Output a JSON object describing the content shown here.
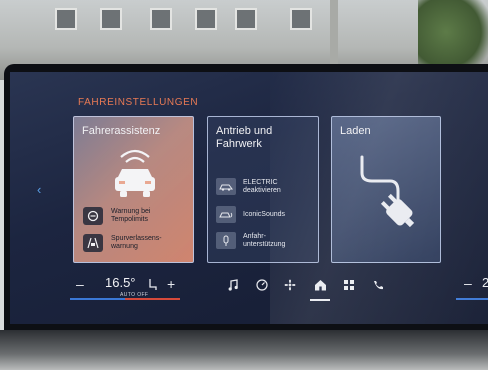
{
  "header": {
    "section_title": "FAHREINSTELLUNGEN"
  },
  "cards": {
    "driver_assist": {
      "title": "Fahrerassistenz",
      "items": [
        {
          "label_line1": "Warnung bei",
          "label_line2": "Tempolimits",
          "icon": "speed-limit-icon"
        },
        {
          "label_line1": "Spurverlassens-",
          "label_line2": "warnung",
          "icon": "lane-departure-icon"
        }
      ]
    },
    "drive": {
      "title_line1": "Antrieb und",
      "title_line2": "Fahrwerk",
      "items": [
        {
          "label_line1": "ELECTRIC",
          "label_line2": "deaktivieren",
          "icon": "car-electric-icon"
        },
        {
          "label_line1": "IconicSounds",
          "label_line2": "",
          "icon": "car-sound-icon"
        },
        {
          "label_line1": "Anfahr-",
          "label_line2": "unterstützung",
          "icon": "hill-start-icon"
        }
      ]
    },
    "charging": {
      "title": "Laden",
      "icon": "charging-plug-icon"
    }
  },
  "climate": {
    "minus": "–",
    "temperature": "16.5°",
    "plus": "+",
    "auto_label": "AUTO OFF",
    "right_minus": "–",
    "right_partial": "2"
  },
  "nav": {
    "items": [
      "music-icon",
      "speedometer-icon",
      "fan-icon",
      "home-icon",
      "apps-icon",
      "phone-icon"
    ],
    "active": "home-icon"
  },
  "colors": {
    "accent_orange": "#e87a55",
    "accent_blue": "#3b78d6",
    "accent_red": "#d64a3b"
  }
}
